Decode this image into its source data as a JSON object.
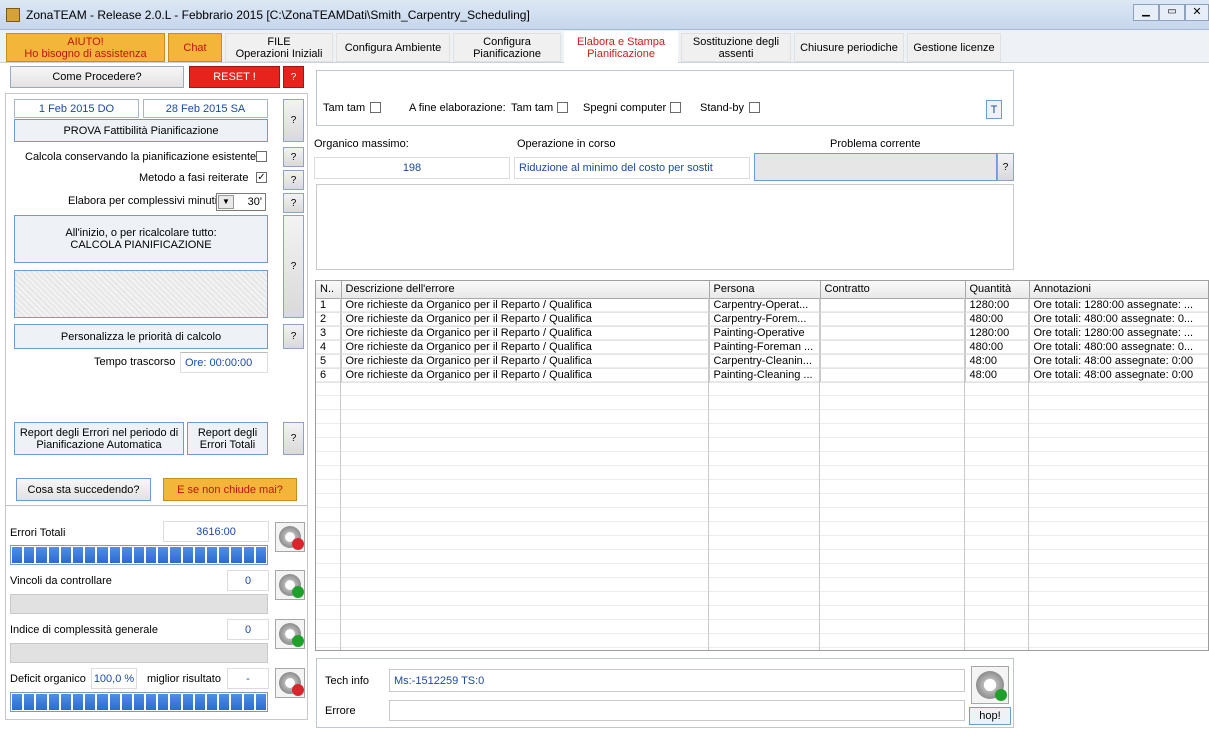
{
  "window": {
    "title": "ZonaTEAM - Release 2.0.L - Febbrario 2015 [C:\\ZonaTEAMDati\\Smith_Carpentry_Scheduling]"
  },
  "tabs": {
    "aiuto_l1": "AIUTO!",
    "aiuto_l2": "Ho bisogno di assistenza",
    "chat": "Chat",
    "file_l1": "FILE",
    "file_l2": "Operazioni Iniziali",
    "configura_ambiente": "Configura Ambiente",
    "configura_pian_l1": "Configura",
    "configura_pian_l2": "Pianificazione",
    "elabora_l1": "Elabora e Stampa",
    "elabora_l2": "Pianificazione",
    "sostituzione_l1": "Sostituzione degli",
    "sostituzione_l2": "assenti",
    "chiusure": "Chiusure periodiche",
    "licenze": "Gestione licenze"
  },
  "left": {
    "come_procedere": "Come Procedere?",
    "reset": "RESET !",
    "q": "?",
    "date_from": "1 Feb 2015 DO",
    "date_to": "28 Feb 2015 SA",
    "prova": "PROVA Fattibilità Pianificazione",
    "calcola_conservando": "Calcola conservando la pianificazione esistente",
    "metodo": "Metodo a fasi reiterate",
    "metodo_check": "✓",
    "elabora_minuti": "Elabora per complessivi minuti",
    "minuti_value": "30'",
    "calcola_l1": "All'inizio, o per ricalcolare tutto:",
    "calcola_l2": "CALCOLA PIANIFICAZIONE",
    "personalizza": "Personalizza le priorità di calcolo",
    "tempo_label": "Tempo trascorso",
    "tempo_value": "Ore: 00:00:00",
    "report_errori_l1": "Report degli Errori nel periodo di",
    "report_errori_l2": "Pianificazione Automatica",
    "report_totali_l1": "Report degli",
    "report_totali_l2": "Errori Totali",
    "cosa_succede": "Cosa sta succedendo?",
    "se_non_chiude": "E se non chiude mai?",
    "errori_totali": "Errori Totali",
    "errori_totali_value": "3616:00",
    "vincoli": "Vincoli da controllare",
    "vincoli_value": "0",
    "indice": "Indice di complessità generale",
    "indice_value": "0",
    "deficit": "Deficit organico",
    "deficit_value": "100,0 %",
    "miglior": "miglior risultato",
    "miglior_value": "-"
  },
  "top": {
    "tam_tam": "Tam tam",
    "a_fine": "A fine elaborazione:",
    "tam_tam2": "Tam tam",
    "spegni": "Spegni computer",
    "standby": "Stand-by",
    "t_button": "T"
  },
  "status": {
    "organico_label": "Organico massimo:",
    "organico_value": "198",
    "operazione_label": "Operazione in corso",
    "operazione_value": "Riduzione al minimo del costo per sostit",
    "problema_label": "Problema corrente"
  },
  "grid": {
    "headers": [
      "N..",
      "Descrizione dell'errore",
      "Persona",
      "Contratto",
      "Quantità",
      "Annotazioni"
    ],
    "rows": [
      [
        "1",
        "Ore richieste da Organico per il Reparto / Qualifica",
        "Carpentry-Operat...",
        "",
        "1280:00",
        "Ore totali: 1280:00 assegnate: ..."
      ],
      [
        "2",
        "Ore richieste da Organico per il Reparto / Qualifica",
        "Carpentry-Forem...",
        "",
        "480:00",
        "Ore totali: 480:00 assegnate: 0..."
      ],
      [
        "3",
        "Ore richieste da Organico per il Reparto / Qualifica",
        "Painting-Operative",
        "",
        "1280:00",
        "Ore totali: 1280:00 assegnate: ..."
      ],
      [
        "4",
        "Ore richieste da Organico per il Reparto / Qualifica",
        "Painting-Foreman ...",
        "",
        "480:00",
        "Ore totali: 480:00 assegnate: 0..."
      ],
      [
        "5",
        "Ore richieste da Organico per il Reparto / Qualifica",
        "Carpentry-Cleanin...",
        "",
        "48:00",
        "Ore totali: 48:00 assegnate: 0:00"
      ],
      [
        "6",
        "Ore richieste da Organico per il Reparto / Qualifica",
        "Painting-Cleaning ...",
        "",
        "48:00",
        "Ore totali: 48:00 assegnate: 0:00"
      ]
    ]
  },
  "bottom": {
    "tech_label": "Tech info",
    "tech_value": "Ms:-1512259 TS:0",
    "errore_label": "Errore",
    "hop": "hop!"
  },
  "colors": {
    "accent_red": "#e8231e",
    "tab_yellow": "#f3b63b",
    "progress_blue": "#2c6ad0"
  }
}
